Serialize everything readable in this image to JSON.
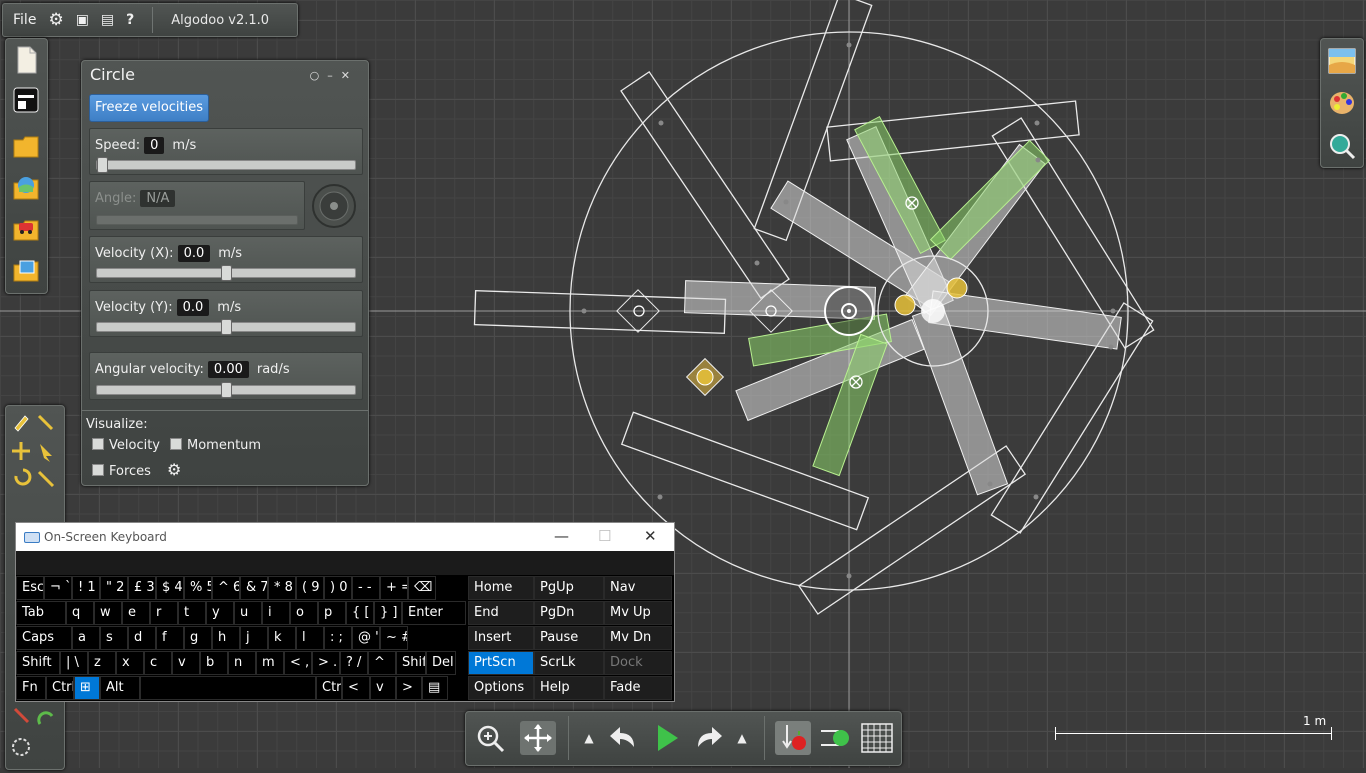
{
  "app": {
    "title": "Algodoo v2.1.0",
    "menu_file": "File"
  },
  "circle_panel": {
    "title": "Circle",
    "freeze_label": "Freeze velocities",
    "speed": {
      "label": "Speed:",
      "value": "0",
      "unit": "m/s",
      "slider_level": 0.0
    },
    "angle": {
      "label": "Angle:",
      "value": "N/A"
    },
    "velocity_x": {
      "label": "Velocity (X):",
      "value": "0.0",
      "unit": "m/s",
      "slider_level": 0.5
    },
    "velocity_y": {
      "label": "Velocity (Y):",
      "value": "0.0",
      "unit": "m/s",
      "slider_level": 0.5
    },
    "angular_velocity": {
      "label": "Angular velocity:",
      "value": "0.00",
      "unit": "rad/s",
      "slider_level": 0.5
    },
    "visualize": {
      "label": "Visualize:",
      "velocity": "Velocity",
      "momentum": "Momentum",
      "forces": "Forces"
    }
  },
  "osk": {
    "title": "On-Screen Keyboard",
    "rows": [
      [
        "Esc",
        "¬ `",
        "! 1",
        "\" 2",
        "£ 3",
        "$ 4",
        "% 5",
        "^ 6",
        "& 7",
        "* 8",
        "( 9",
        ") 0",
        "- -",
        "+ =",
        "⌫"
      ],
      [
        "Tab",
        "q",
        "w",
        "e",
        "r",
        "t",
        "y",
        "u",
        "i",
        "o",
        "p",
        "{ [",
        "} ]",
        "Enter"
      ],
      [
        "Caps",
        "a",
        "s",
        "d",
        "f",
        "g",
        "h",
        "j",
        "k",
        "l",
        ": ;",
        "@ '",
        "~ #"
      ],
      [
        "Shift",
        "| \\",
        "z",
        "x",
        "c",
        "v",
        "b",
        "n",
        "m",
        "< ,",
        "> .",
        "? /",
        "^",
        "Shift",
        "Del"
      ],
      [
        "Fn",
        "Ctrl",
        "⊞",
        "Alt",
        "",
        "Ctrl",
        "<",
        "v",
        ">",
        "▤"
      ]
    ],
    "nav_keys": [
      [
        "Home",
        "PgUp",
        "Nav"
      ],
      [
        "End",
        "PgDn",
        "Mv Up"
      ],
      [
        "Insert",
        "Pause",
        "Mv Dn"
      ],
      [
        "PrtScn",
        "ScrLk",
        "Dock"
      ],
      [
        "Options",
        "Help",
        "Fade"
      ]
    ]
  },
  "scale_label": "1 m",
  "colors": {
    "accent": "#0078d7",
    "freeze_button": "#4a8bd4",
    "selected_shape": "#7ec85a",
    "hinge_yellow": "#e8c23a"
  }
}
